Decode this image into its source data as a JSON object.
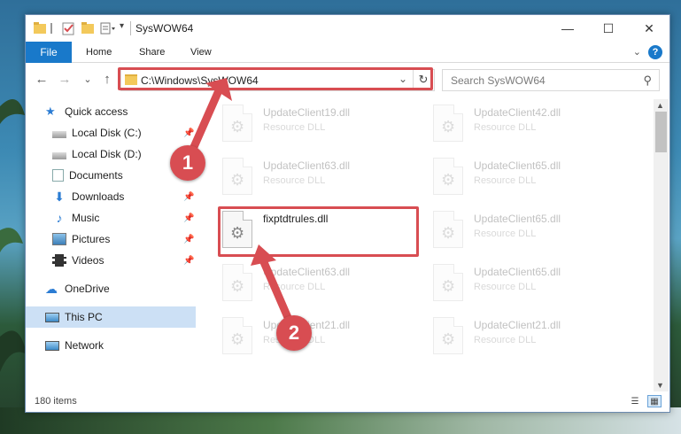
{
  "window": {
    "title": "SysWOW64",
    "controls": {
      "minimize": "—",
      "maximize": "☐",
      "close": "✕"
    }
  },
  "ribbon": {
    "tabs": [
      "File",
      "Home",
      "Share",
      "View"
    ],
    "help": "?"
  },
  "navigation": {
    "back": "←",
    "forward": "→",
    "recent": "⌄",
    "up": "↑",
    "address": "C:\\Windows\\SysWOW64",
    "refresh": "↻",
    "search_placeholder": "Search SysWOW64"
  },
  "sidebar": {
    "items": [
      {
        "label": "Quick access",
        "icon": "star-icon",
        "pinned": false
      },
      {
        "label": "Local Disk (C:)",
        "icon": "drive-icon",
        "pinned": true
      },
      {
        "label": "Local Disk (D:)",
        "icon": "drive-icon",
        "pinned": false
      },
      {
        "label": "Documents",
        "icon": "documents-icon",
        "pinned": true
      },
      {
        "label": "Downloads",
        "icon": "download-icon",
        "pinned": true
      },
      {
        "label": "Music",
        "icon": "music-icon",
        "pinned": true
      },
      {
        "label": "Pictures",
        "icon": "pictures-icon",
        "pinned": true
      },
      {
        "label": "Videos",
        "icon": "videos-icon",
        "pinned": true
      },
      {
        "label": "OneDrive",
        "icon": "cloud-icon",
        "pinned": false
      },
      {
        "label": "This PC",
        "icon": "computer-icon",
        "pinned": false,
        "selected": true
      },
      {
        "label": "Network",
        "icon": "network-icon",
        "pinned": false
      }
    ]
  },
  "files": [
    {
      "name": "UpdateClient19.dll",
      "type": "Resource DLL"
    },
    {
      "name": "UpdateClient42.dll",
      "type": "Resource DLL"
    },
    {
      "name": "UpdateClient63.dll",
      "type": "Resource DLL"
    },
    {
      "name": "UpdateClient65.dll",
      "type": "Resource DLL"
    },
    {
      "name": "fixptdtrules.dll",
      "type": "",
      "highlighted": true
    },
    {
      "name": "UpdateClient65.dll",
      "type": "Resource DLL"
    },
    {
      "name": "UpdateClient63.dll",
      "type": "Resource DLL"
    },
    {
      "name": "UpdateClient65.dll",
      "type": "Resource DLL"
    },
    {
      "name": "UpdateClient21.dll",
      "type": "Resource DLL"
    },
    {
      "name": "UpdateClient21.dll",
      "type": "Resource DLL"
    }
  ],
  "status": {
    "count": "180 items"
  },
  "callouts": [
    "1",
    "2"
  ],
  "colors": {
    "accent": "#1979ca",
    "highlight": "#d84d52",
    "selected": "#cce0f5"
  }
}
